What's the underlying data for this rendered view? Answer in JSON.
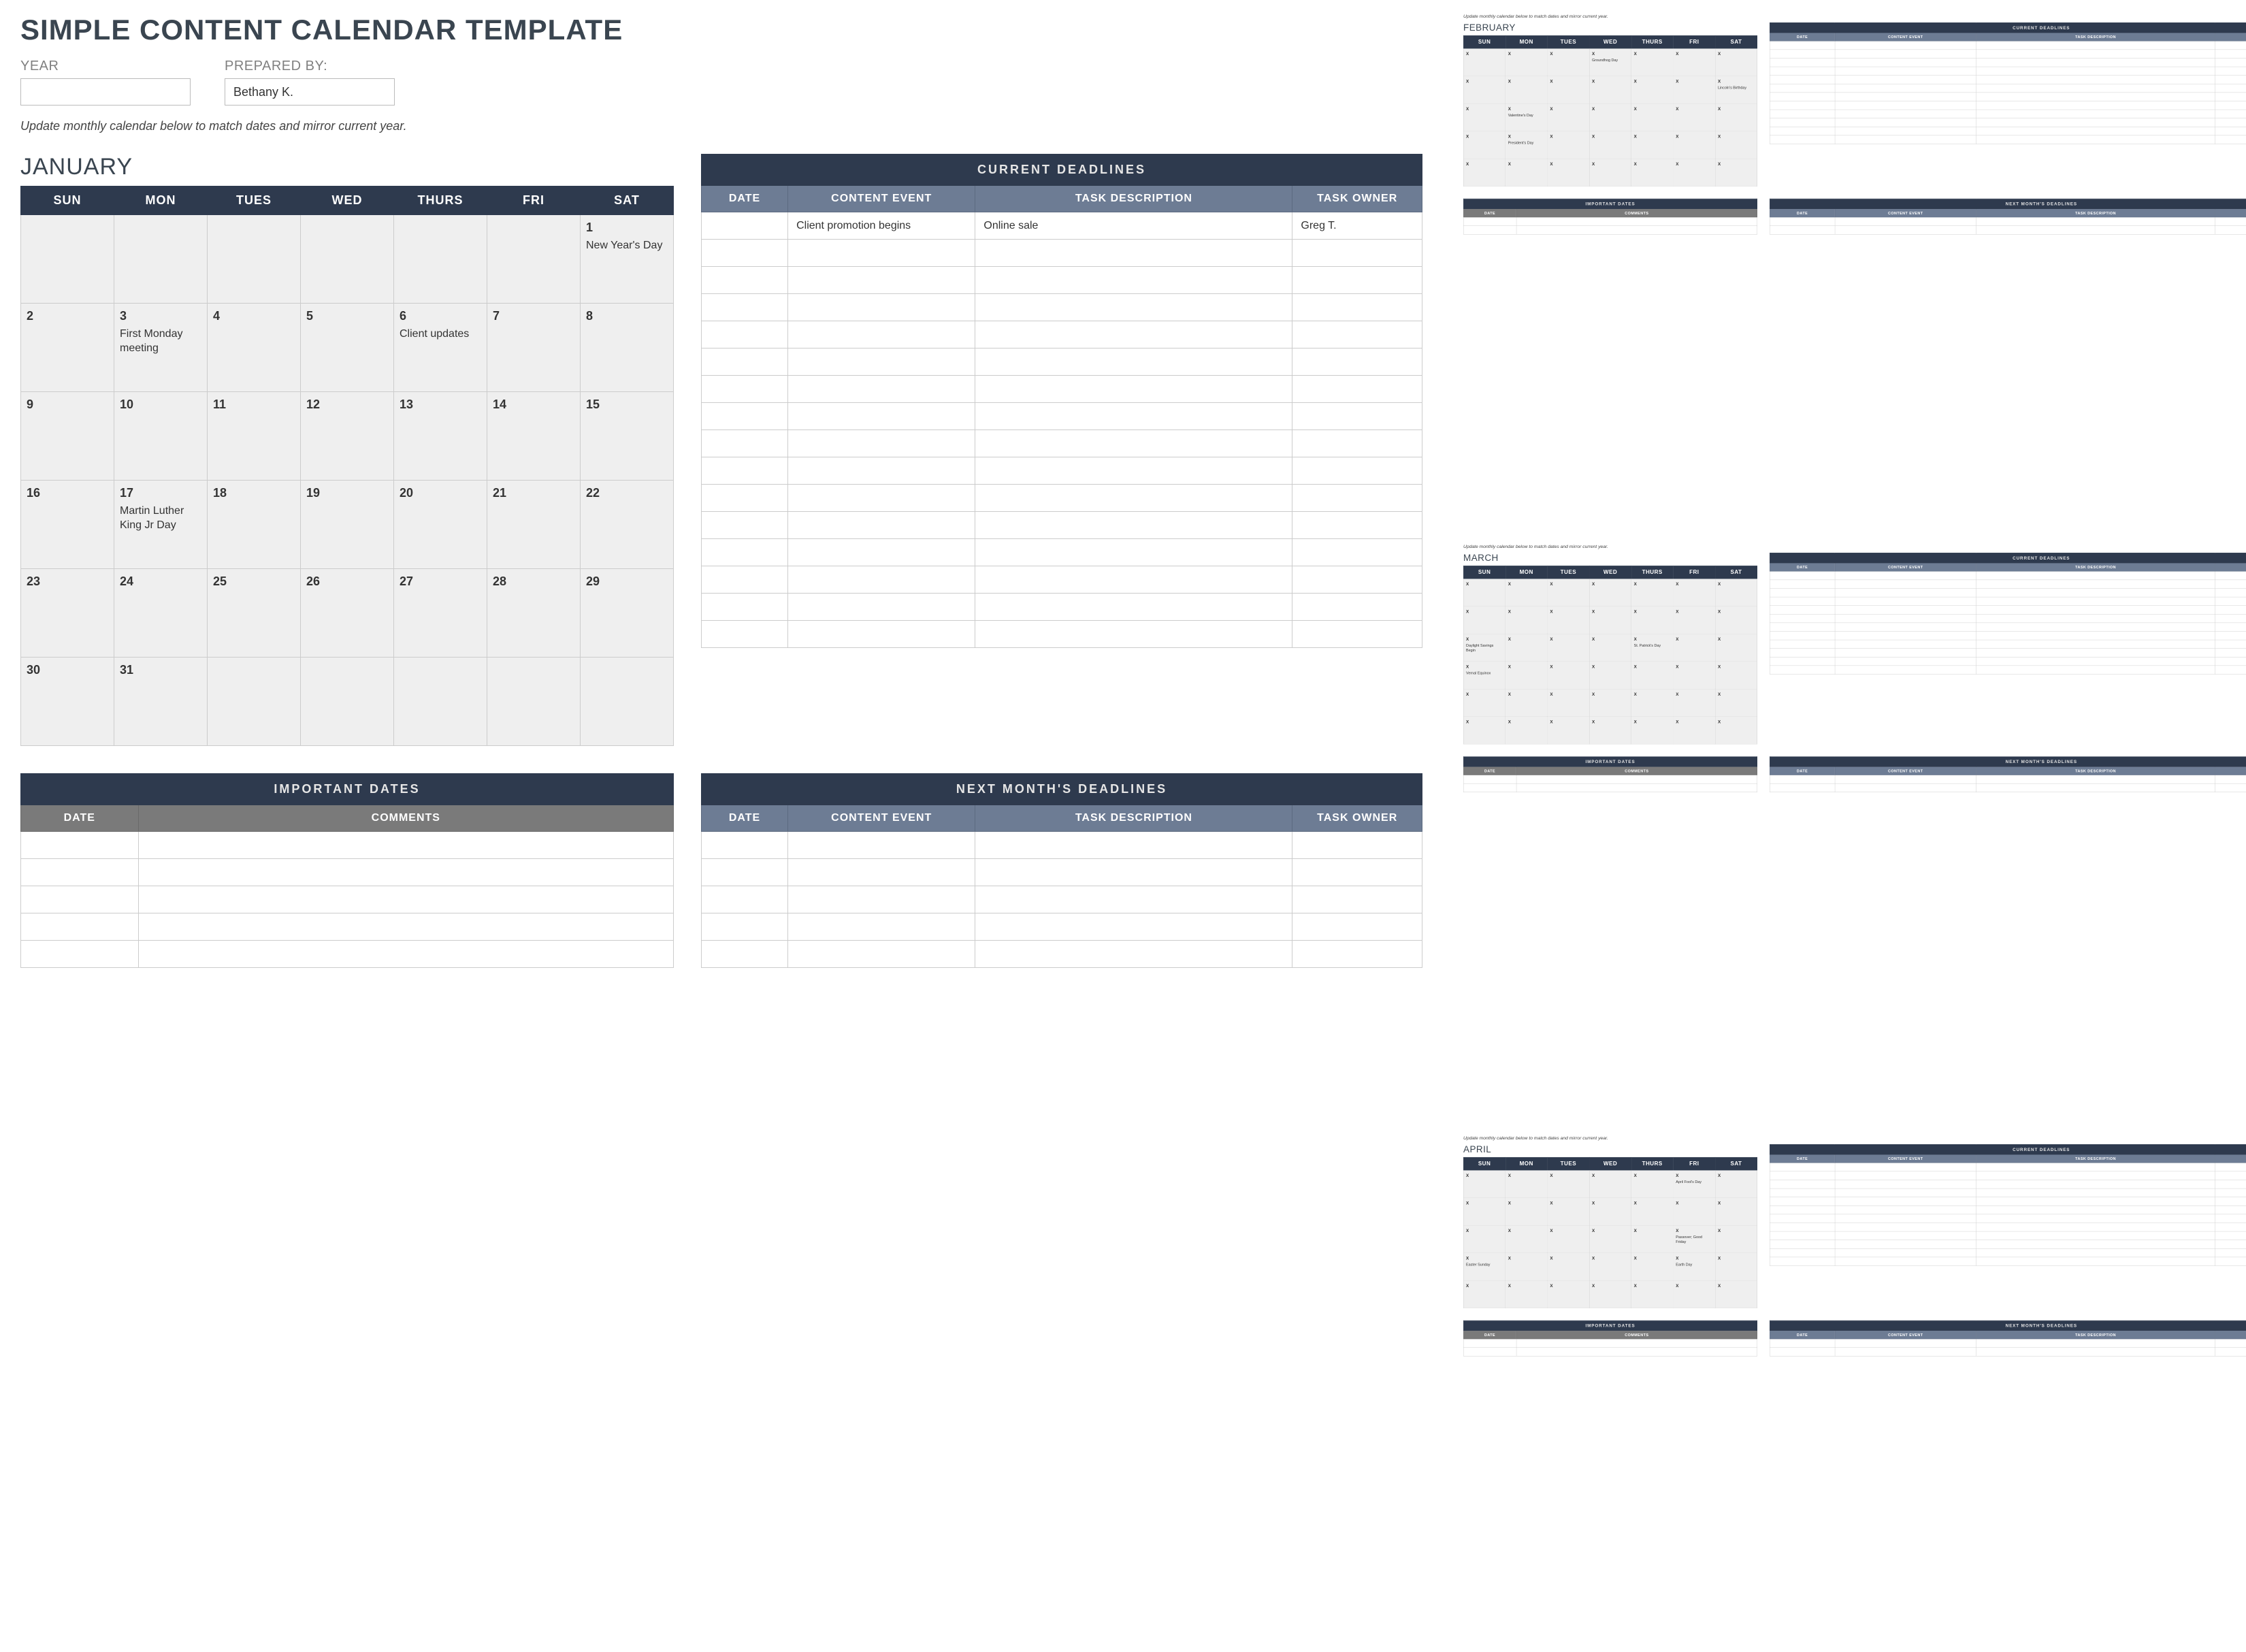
{
  "header": {
    "title": "SIMPLE CONTENT CALENDAR TEMPLATE",
    "year_label": "YEAR",
    "year_value": "",
    "prepared_by_label": "PREPARED BY:",
    "prepared_by_value": "Bethany K.",
    "instruction": "Update monthly calendar below to match dates and mirror current year."
  },
  "labels": {
    "days": [
      "SUN",
      "MON",
      "TUES",
      "WED",
      "THURS",
      "FRI",
      "SAT"
    ],
    "current_deadlines": "CURRENT DEADLINES",
    "next_deadlines": "NEXT MONTH'S DEADLINES",
    "important_dates": "IMPORTANT DATES",
    "col_date": "DATE",
    "col_content_event": "CONTENT EVENT",
    "col_task_desc": "TASK DESCRIPTION",
    "col_task_owner": "TASK OWNER",
    "col_comments": "COMMENTS"
  },
  "months": [
    {
      "name": "JANUARY",
      "weeks": [
        [
          {
            "n": "",
            "e": ""
          },
          {
            "n": "",
            "e": ""
          },
          {
            "n": "",
            "e": ""
          },
          {
            "n": "",
            "e": ""
          },
          {
            "n": "",
            "e": ""
          },
          {
            "n": "",
            "e": ""
          },
          {
            "n": "1",
            "e": "New Year's Day"
          }
        ],
        [
          {
            "n": "2",
            "e": ""
          },
          {
            "n": "3",
            "e": "First Monday meeting"
          },
          {
            "n": "4",
            "e": ""
          },
          {
            "n": "5",
            "e": ""
          },
          {
            "n": "6",
            "e": "Client updates"
          },
          {
            "n": "7",
            "e": ""
          },
          {
            "n": "8",
            "e": ""
          }
        ],
        [
          {
            "n": "9",
            "e": ""
          },
          {
            "n": "10",
            "e": ""
          },
          {
            "n": "11",
            "e": ""
          },
          {
            "n": "12",
            "e": ""
          },
          {
            "n": "13",
            "e": ""
          },
          {
            "n": "14",
            "e": ""
          },
          {
            "n": "15",
            "e": ""
          }
        ],
        [
          {
            "n": "16",
            "e": ""
          },
          {
            "n": "17",
            "e": "Martin Luther King Jr Day"
          },
          {
            "n": "18",
            "e": ""
          },
          {
            "n": "19",
            "e": ""
          },
          {
            "n": "20",
            "e": ""
          },
          {
            "n": "21",
            "e": ""
          },
          {
            "n": "22",
            "e": ""
          }
        ],
        [
          {
            "n": "23",
            "e": ""
          },
          {
            "n": "24",
            "e": ""
          },
          {
            "n": "25",
            "e": ""
          },
          {
            "n": "26",
            "e": ""
          },
          {
            "n": "27",
            "e": ""
          },
          {
            "n": "28",
            "e": ""
          },
          {
            "n": "29",
            "e": ""
          }
        ],
        [
          {
            "n": "30",
            "e": ""
          },
          {
            "n": "31",
            "e": ""
          },
          {
            "n": "",
            "e": ""
          },
          {
            "n": "",
            "e": ""
          },
          {
            "n": "",
            "e": ""
          },
          {
            "n": "",
            "e": ""
          },
          {
            "n": "",
            "e": ""
          }
        ]
      ],
      "deadlines": [
        {
          "date": "",
          "event": "Client promotion begins",
          "desc": "Online sale",
          "owner": "Greg T."
        }
      ]
    },
    {
      "name": "FEBRUARY",
      "weeks": [
        [
          {
            "n": "X",
            "e": ""
          },
          {
            "n": "X",
            "e": ""
          },
          {
            "n": "X",
            "e": ""
          },
          {
            "n": "X",
            "e": "Groundhog Day"
          },
          {
            "n": "X",
            "e": ""
          },
          {
            "n": "X",
            "e": ""
          },
          {
            "n": "X",
            "e": ""
          }
        ],
        [
          {
            "n": "X",
            "e": ""
          },
          {
            "n": "X",
            "e": ""
          },
          {
            "n": "X",
            "e": ""
          },
          {
            "n": "X",
            "e": ""
          },
          {
            "n": "X",
            "e": ""
          },
          {
            "n": "X",
            "e": ""
          },
          {
            "n": "X",
            "e": "Lincoln's Birthday"
          }
        ],
        [
          {
            "n": "X",
            "e": ""
          },
          {
            "n": "X",
            "e": "Valentine's Day"
          },
          {
            "n": "X",
            "e": ""
          },
          {
            "n": "X",
            "e": ""
          },
          {
            "n": "X",
            "e": ""
          },
          {
            "n": "X",
            "e": ""
          },
          {
            "n": "X",
            "e": ""
          }
        ],
        [
          {
            "n": "X",
            "e": ""
          },
          {
            "n": "X",
            "e": "President's Day"
          },
          {
            "n": "X",
            "e": ""
          },
          {
            "n": "X",
            "e": ""
          },
          {
            "n": "X",
            "e": ""
          },
          {
            "n": "X",
            "e": ""
          },
          {
            "n": "X",
            "e": ""
          }
        ],
        [
          {
            "n": "X",
            "e": ""
          },
          {
            "n": "X",
            "e": ""
          },
          {
            "n": "X",
            "e": ""
          },
          {
            "n": "X",
            "e": ""
          },
          {
            "n": "X",
            "e": ""
          },
          {
            "n": "X",
            "e": ""
          },
          {
            "n": "X",
            "e": ""
          }
        ]
      ],
      "deadlines": []
    },
    {
      "name": "MARCH",
      "weeks": [
        [
          {
            "n": "X",
            "e": ""
          },
          {
            "n": "X",
            "e": ""
          },
          {
            "n": "X",
            "e": ""
          },
          {
            "n": "X",
            "e": ""
          },
          {
            "n": "X",
            "e": ""
          },
          {
            "n": "X",
            "e": ""
          },
          {
            "n": "X",
            "e": ""
          }
        ],
        [
          {
            "n": "X",
            "e": ""
          },
          {
            "n": "X",
            "e": ""
          },
          {
            "n": "X",
            "e": ""
          },
          {
            "n": "X",
            "e": ""
          },
          {
            "n": "X",
            "e": ""
          },
          {
            "n": "X",
            "e": ""
          },
          {
            "n": "X",
            "e": ""
          }
        ],
        [
          {
            "n": "X",
            "e": "Daylight Savings Begin"
          },
          {
            "n": "X",
            "e": ""
          },
          {
            "n": "X",
            "e": ""
          },
          {
            "n": "X",
            "e": ""
          },
          {
            "n": "X",
            "e": "St. Patrick's Day"
          },
          {
            "n": "X",
            "e": ""
          },
          {
            "n": "X",
            "e": ""
          }
        ],
        [
          {
            "n": "X",
            "e": "Vernal Equinox"
          },
          {
            "n": "X",
            "e": ""
          },
          {
            "n": "X",
            "e": ""
          },
          {
            "n": "X",
            "e": ""
          },
          {
            "n": "X",
            "e": ""
          },
          {
            "n": "X",
            "e": ""
          },
          {
            "n": "X",
            "e": ""
          }
        ],
        [
          {
            "n": "X",
            "e": ""
          },
          {
            "n": "X",
            "e": ""
          },
          {
            "n": "X",
            "e": ""
          },
          {
            "n": "X",
            "e": ""
          },
          {
            "n": "X",
            "e": ""
          },
          {
            "n": "X",
            "e": ""
          },
          {
            "n": "X",
            "e": ""
          }
        ],
        [
          {
            "n": "X",
            "e": ""
          },
          {
            "n": "X",
            "e": ""
          },
          {
            "n": "X",
            "e": ""
          },
          {
            "n": "X",
            "e": ""
          },
          {
            "n": "X",
            "e": ""
          },
          {
            "n": "X",
            "e": ""
          },
          {
            "n": "X",
            "e": ""
          }
        ]
      ],
      "deadlines": []
    },
    {
      "name": "APRIL",
      "weeks": [
        [
          {
            "n": "X",
            "e": ""
          },
          {
            "n": "X",
            "e": ""
          },
          {
            "n": "X",
            "e": ""
          },
          {
            "n": "X",
            "e": ""
          },
          {
            "n": "X",
            "e": ""
          },
          {
            "n": "X",
            "e": "April Fool's Day"
          },
          {
            "n": "X",
            "e": ""
          }
        ],
        [
          {
            "n": "X",
            "e": ""
          },
          {
            "n": "X",
            "e": ""
          },
          {
            "n": "X",
            "e": ""
          },
          {
            "n": "X",
            "e": ""
          },
          {
            "n": "X",
            "e": ""
          },
          {
            "n": "X",
            "e": ""
          },
          {
            "n": "X",
            "e": ""
          }
        ],
        [
          {
            "n": "X",
            "e": ""
          },
          {
            "n": "X",
            "e": ""
          },
          {
            "n": "X",
            "e": ""
          },
          {
            "n": "X",
            "e": ""
          },
          {
            "n": "X",
            "e": ""
          },
          {
            "n": "X",
            "e": "Passover; Good Friday"
          },
          {
            "n": "X",
            "e": ""
          }
        ],
        [
          {
            "n": "X",
            "e": "Easter Sunday"
          },
          {
            "n": "X",
            "e": ""
          },
          {
            "n": "X",
            "e": ""
          },
          {
            "n": "X",
            "e": ""
          },
          {
            "n": "X",
            "e": ""
          },
          {
            "n": "X",
            "e": "Earth Day"
          },
          {
            "n": "X",
            "e": ""
          }
        ],
        [
          {
            "n": "X",
            "e": ""
          },
          {
            "n": "X",
            "e": ""
          },
          {
            "n": "X",
            "e": ""
          },
          {
            "n": "X",
            "e": ""
          },
          {
            "n": "X",
            "e": ""
          },
          {
            "n": "X",
            "e": ""
          },
          {
            "n": "X",
            "e": ""
          }
        ]
      ],
      "deadlines": []
    }
  ]
}
